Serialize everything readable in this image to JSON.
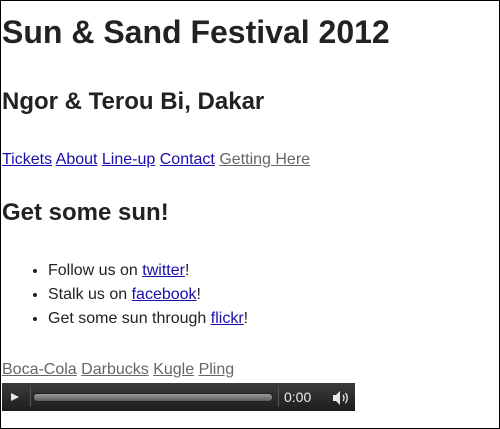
{
  "page": {
    "title": "Sun & Sand Festival 2012",
    "subtitle": "Ngor & Terou Bi, Dakar"
  },
  "nav": {
    "items": [
      "Tickets",
      "About",
      "Line-up",
      "Contact",
      "Getting Here"
    ]
  },
  "section": {
    "heading": "Get some sun!",
    "social": [
      {
        "prefix": "Follow us on ",
        "link": "twitter",
        "suffix": "!"
      },
      {
        "prefix": "Stalk us on ",
        "link": "facebook",
        "suffix": "!"
      },
      {
        "prefix": "Get some sun through ",
        "link": "flickr",
        "suffix": "!"
      }
    ]
  },
  "sponsors": {
    "items": [
      "Boca-Cola",
      "Darbucks",
      "Kugle",
      "Pling"
    ]
  },
  "player": {
    "time": "0:00",
    "progress": 0,
    "play_icon": "play-icon",
    "volume_icon": "volume-icon"
  },
  "colors": {
    "link": "#1a0dab",
    "visited_link": "#551a8b",
    "player_bg": "#2a2a2a"
  }
}
